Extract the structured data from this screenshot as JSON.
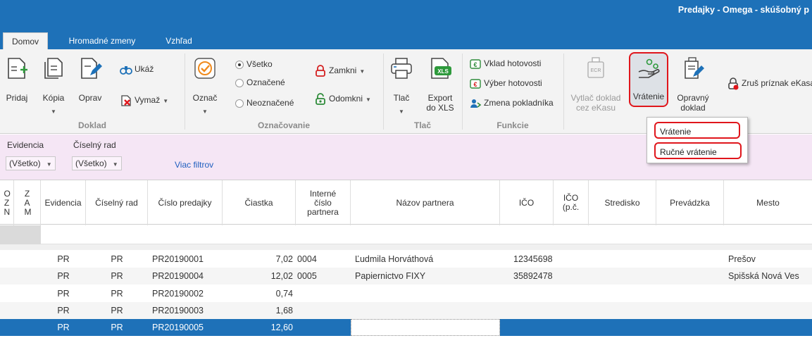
{
  "window": {
    "title": "Predajky - Omega - skúšobný p"
  },
  "tabs": [
    {
      "label": "Domov",
      "active": true
    },
    {
      "label": "Hromadné zmeny",
      "active": false
    },
    {
      "label": "Vzhľad",
      "active": false
    }
  ],
  "ribbon": {
    "doklad": {
      "label": "Doklad",
      "pridaj": "Pridaj",
      "kopia": "Kópia",
      "oprav": "Oprav",
      "ukaz": "Ukáž",
      "vymaz": "Vymaž"
    },
    "oznacovanie": {
      "label": "Označovanie",
      "oznac": "Označ",
      "radio_all": "Všetko",
      "radio_marked": "Označené",
      "radio_unmarked": "Neoznačené",
      "selected": "Všetko",
      "zamkni": "Zamkni",
      "odomkni": "Odomkni"
    },
    "tlac": {
      "label": "Tlač",
      "tlac": "Tlač",
      "export_line1": "Export",
      "export_line2": "do XLS",
      "xls_badge": "XLS"
    },
    "funkcie": {
      "label": "Funkcie",
      "vklad": "Vklad hotovosti",
      "vyber": "Výber hotovosti",
      "zmena": "Zmena pokladníka"
    },
    "ekasa": {
      "vytlac_line1": "Vytlač doklad",
      "vytlac_line2": "cez eKasu",
      "ecr_badge": "ECR",
      "vratenie": "Vrátenie",
      "opravny_line1": "Opravný",
      "opravny_line2": "doklad",
      "zrus": "Zruš príznak eKasa"
    }
  },
  "vratenie_menu": [
    {
      "label": "Vrátenie"
    },
    {
      "label": "Ručné vrátenie"
    }
  ],
  "filters": {
    "evidencia_label": "Evidencia",
    "rad_label": "Číselný rad",
    "evidencia_value": "(Všetko)",
    "rad_value": "(Všetko)",
    "more": "Viac filtrov"
  },
  "grid": {
    "headers": {
      "ozn": "O Z N",
      "zam": "Z A M",
      "evidencia": "Evidencia",
      "rad": "Číselný rad",
      "cislo": "Číslo predajky",
      "ciastka": "Čiastka",
      "interne_1": "Interné",
      "interne_2": "číslo",
      "interne_3": "partnera",
      "nazov": "Názov partnera",
      "ico": "IČO",
      "ico_pc_1": "IČO",
      "ico_pc_2": "(p.č.",
      "stredisko": "Stredisko",
      "prevadzka": "Prevádzka",
      "mesto": "Mesto"
    },
    "rows": [
      {
        "evidencia": "PR",
        "rad": "PR",
        "cislo": "PR20190001",
        "ciastka": "7,02",
        "interne": "0004",
        "nazov": "Ľudmila Horváthová",
        "ico": "12345698",
        "mesto": "Prešov"
      },
      {
        "evidencia": "PR",
        "rad": "PR",
        "cislo": "PR20190004",
        "ciastka": "12,02",
        "interne": "0005",
        "nazov": "Papiernictvo FIXY",
        "ico": "35892478",
        "mesto": "Spišská Nová Ves"
      },
      {
        "evidencia": "PR",
        "rad": "PR",
        "cislo": "PR20190002",
        "ciastka": "0,74",
        "interne": "",
        "nazov": "",
        "ico": "",
        "mesto": ""
      },
      {
        "evidencia": "PR",
        "rad": "PR",
        "cislo": "PR20190003",
        "ciastka": "1,68",
        "interne": "",
        "nazov": "",
        "ico": "",
        "mesto": ""
      },
      {
        "evidencia": "PR",
        "rad": "PR",
        "cislo": "PR20190005",
        "ciastka": "12,60",
        "interne": "",
        "nazov": "",
        "ico": "",
        "mesto": ""
      }
    ]
  },
  "colors": {
    "accent": "#1e71b8",
    "highlight": "#e0161c",
    "filter_bg": "#f5e6f5",
    "lock_red": "#d42020",
    "unlock_green": "#2e8b3a"
  }
}
